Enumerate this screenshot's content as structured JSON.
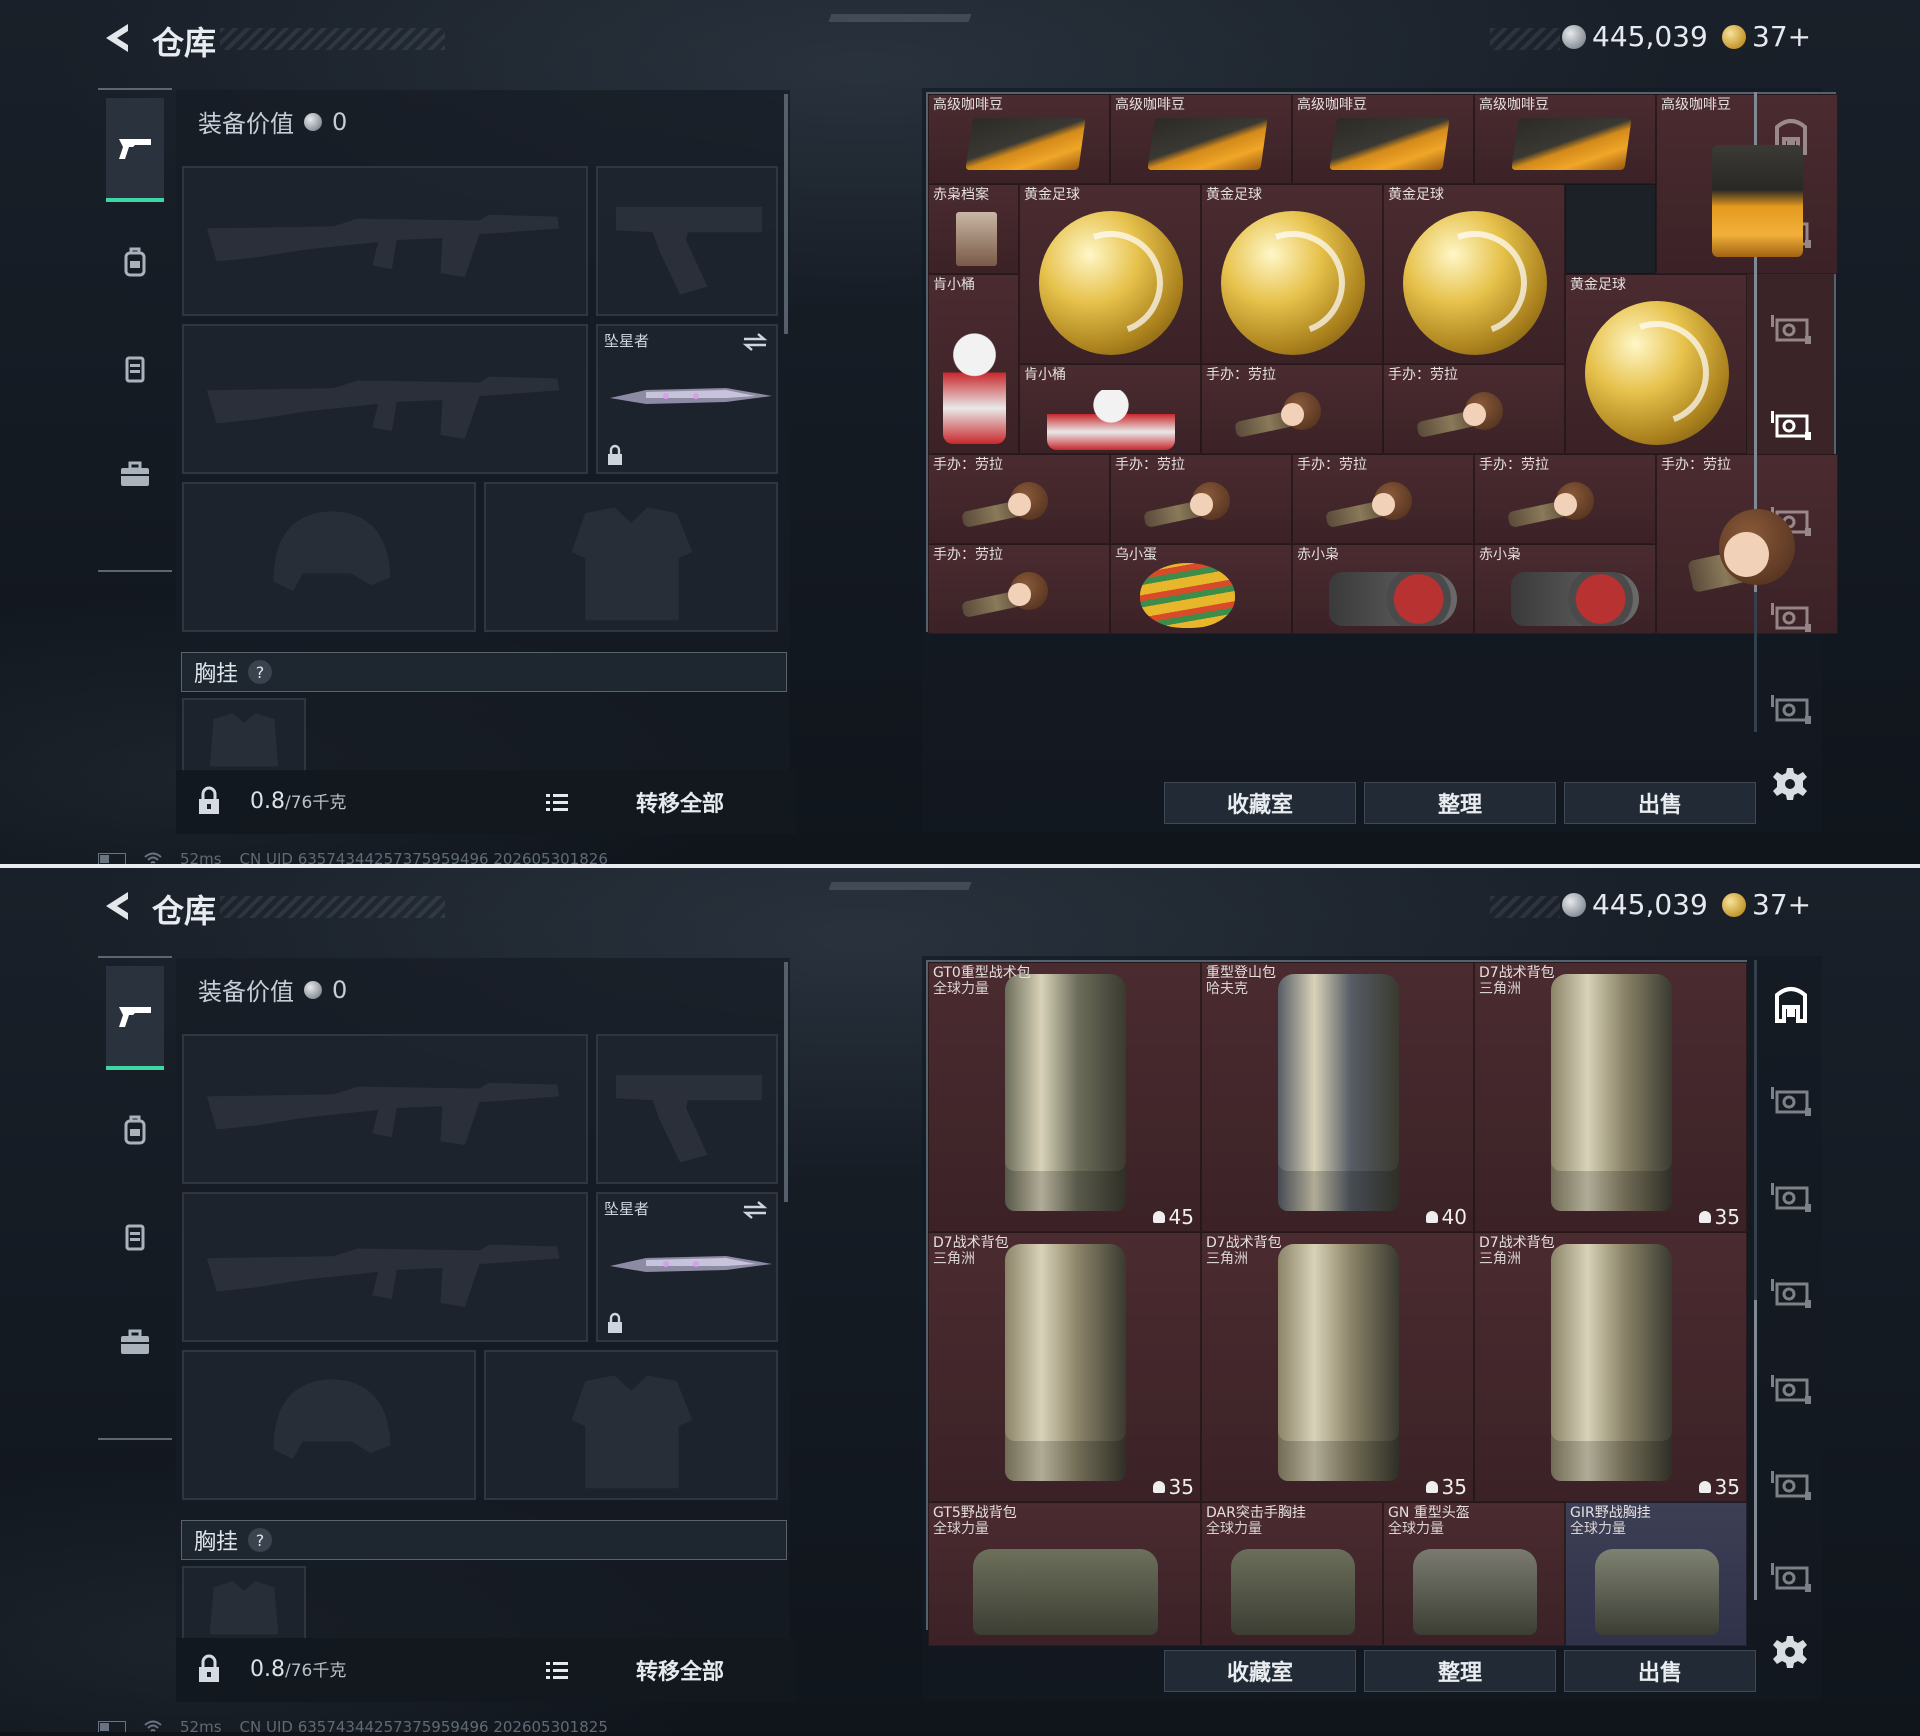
{
  "app": {
    "title": "仓库"
  },
  "currency": {
    "silver": "445,039",
    "gold": "37+"
  },
  "equipment": {
    "value_label": "装备价值",
    "value": "0",
    "melee_name": "坠星者",
    "vest_label": "胸挂",
    "vest_help": "?"
  },
  "weight": {
    "current": "0.8",
    "max": "/76千克"
  },
  "left_actions": {
    "transfer_all": "转移全部"
  },
  "right_actions": {
    "collection": "收藏室",
    "organize": "整理",
    "sell": "出售"
  },
  "status": {
    "ping": "52ms",
    "uid_top": "CN UID 63574344257375959496 202605301826",
    "uid_bottom": "CN UID 63574344257375959496 202605301825"
  },
  "screens": [
    {
      "items": [
        {
          "label": "高级咖啡豆"
        },
        {
          "label": "高级咖啡豆"
        },
        {
          "label": "高级咖啡豆"
        },
        {
          "label": "高级咖啡豆"
        },
        {
          "label": "高级咖啡豆"
        },
        {
          "label": "赤枭档案"
        },
        {
          "label": "黄金足球"
        },
        {
          "label": "黄金足球"
        },
        {
          "label": "黄金足球"
        },
        {
          "label": "肯小桶"
        },
        {
          "label": "黄金足球"
        },
        {
          "label": "肯小桶"
        },
        {
          "label": "手办：劳拉"
        },
        {
          "label": "手办：劳拉"
        },
        {
          "label": "手办：劳拉"
        },
        {
          "label": "手办：劳拉"
        },
        {
          "label": "手办：劳拉"
        },
        {
          "label": "手办：劳拉"
        },
        {
          "label": "手办：劳拉"
        },
        {
          "label": "手办：劳拉"
        },
        {
          "label": "乌小蛋"
        },
        {
          "label": "赤小枭"
        },
        {
          "label": "赤小枭"
        }
      ]
    },
    {
      "items": [
        {
          "label": "GT0重型战术包",
          "sub": "全球力量",
          "count": "45"
        },
        {
          "label": "重型登山包",
          "sub": "哈夫克",
          "count": "40"
        },
        {
          "label": "D7战术背包",
          "sub": "三角洲",
          "count": "35"
        },
        {
          "label": "D7战术背包",
          "sub": "三角洲",
          "count": "35"
        },
        {
          "label": "D7战术背包",
          "sub": "三角洲",
          "count": "35"
        },
        {
          "label": "D7战术背包",
          "sub": "三角洲",
          "count": "35"
        },
        {
          "label": "GT5野战背包",
          "sub": "全球力量"
        },
        {
          "label": "DAR突击手胸挂",
          "sub": "全球力量"
        },
        {
          "label": "GN 重型头盔",
          "sub": "全球力量"
        },
        {
          "label": "GIR野战胸挂",
          "sub": "全球力量"
        }
      ]
    }
  ],
  "icons": [
    "back-arrow-icon",
    "silver-coin-icon",
    "gold-coin-icon",
    "pistol-icon",
    "backpack-icon",
    "vest-icon",
    "briefcase-icon",
    "lock-icon",
    "list-icon",
    "swap-icon",
    "gear-icon",
    "safe-icon",
    "storage-tab-icon"
  ],
  "colors": {
    "accent": "#3ed6a2",
    "item_bg": "#4a2b30",
    "panel": "#161c24"
  }
}
